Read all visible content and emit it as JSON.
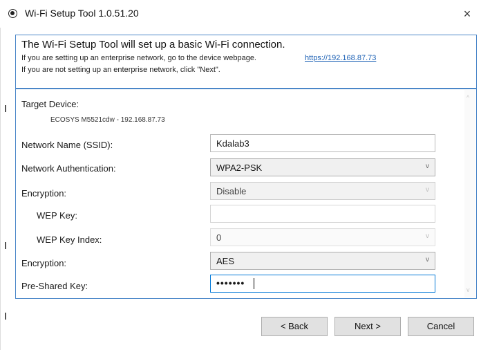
{
  "window": {
    "title": "Wi-Fi Setup Tool 1.0.51.20",
    "close_glyph": "×"
  },
  "header": {
    "heading": "The Wi-Fi Setup Tool will set up a basic Wi-Fi connection.",
    "enterprise_text": "If you are setting up an enterprise network, go to the device webpage.",
    "link": "https://192.168.87.73",
    "basic_text": "If you are not setting up an enterprise network, click \"Next\"."
  },
  "form": {
    "target_label": "Target Device:",
    "target_value": "ECOSYS M5521cdw - 192.168.87.73",
    "ssid_label": "Network Name (SSID):",
    "ssid_value": "Kdalab3",
    "auth_label": "Network Authentication:",
    "auth_value": "WPA2-PSK",
    "enc1_label": "Encryption:",
    "enc1_value": "Disable",
    "wep_key_label": "WEP Key:",
    "wep_key_value": "",
    "wep_index_label": "WEP Key Index:",
    "wep_index_value": "0",
    "enc2_label": "Encryption:",
    "enc2_value": "AES",
    "psk_label": "Pre-Shared Key:",
    "psk_value": "•••••••"
  },
  "icons": {
    "chevron": "v",
    "scroll_up": "^",
    "scroll_down": "v"
  },
  "buttons": {
    "back": "< Back",
    "next": "Next >",
    "cancel": "Cancel"
  },
  "colors": {
    "border_accent": "#4a86c8",
    "link": "#1a5fb4",
    "focus": "#0078d7"
  }
}
